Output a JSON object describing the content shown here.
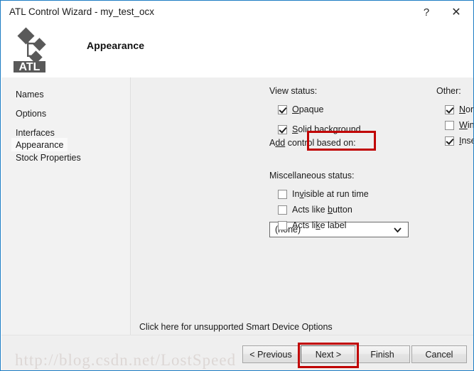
{
  "window": {
    "title": "ATL Control Wizard - my_test_ocx",
    "help_glyph": "?",
    "close_glyph": "✕"
  },
  "header": {
    "page_title": "Appearance",
    "logo_text": "ATL"
  },
  "sidebar": {
    "items": [
      {
        "label": "Names",
        "selected": false
      },
      {
        "label": "Options",
        "selected": false
      },
      {
        "label": "Interfaces",
        "selected": false
      },
      {
        "label": "Appearance",
        "selected": true
      },
      {
        "label": "Stock Properties",
        "selected": false
      }
    ]
  },
  "content": {
    "view_status": {
      "label": "View status:",
      "items": [
        {
          "label_pre": "",
          "accel": "O",
          "label_post": "paque",
          "checked": true
        },
        {
          "label_pre": "",
          "accel": "S",
          "label_post": "olid background",
          "checked": true
        }
      ]
    },
    "add_control": {
      "label_pre": "A",
      "accel": "dd",
      "label_post": " control based on:",
      "value": "(none)"
    },
    "misc_status": {
      "label": "Miscellaneous status:",
      "items": [
        {
          "label_pre": "In",
          "accel": "v",
          "label_post": "isible at run time",
          "checked": false
        },
        {
          "label_pre": "Acts like ",
          "accel": "b",
          "label_post": "utton",
          "checked": false
        },
        {
          "label_pre": "Acts li",
          "accel": "k",
          "label_post": "e label",
          "checked": false
        }
      ]
    },
    "other": {
      "label": "Other:",
      "items": [
        {
          "label_pre": "",
          "accel": "N",
          "label_post": "ormalized DC",
          "checked": true,
          "highlighted": false
        },
        {
          "label_pre": "",
          "accel": "W",
          "label_post": "indowed only",
          "checked": false,
          "highlighted": false
        },
        {
          "label_pre": "",
          "accel": "I",
          "label_post": "nsertable",
          "checked": true,
          "highlighted": true
        }
      ]
    },
    "smart_device_text": "Click here for unsupported Smart Device Options"
  },
  "footer": {
    "watermark": "http://blog.csdn.net/LostSpeed",
    "buttons": [
      {
        "label": "< Previous",
        "default": false,
        "highlighted": false
      },
      {
        "label": "Next >",
        "default": true,
        "highlighted": true
      },
      {
        "label": "Finish",
        "default": false,
        "highlighted": false
      },
      {
        "label": "Cancel",
        "default": false,
        "highlighted": false
      }
    ]
  },
  "colors": {
    "window_border": "#1d7dc4",
    "annotation_red": "#c00000",
    "panel_bg": "#efefef",
    "sidebar_bg": "#f2f2f2"
  }
}
